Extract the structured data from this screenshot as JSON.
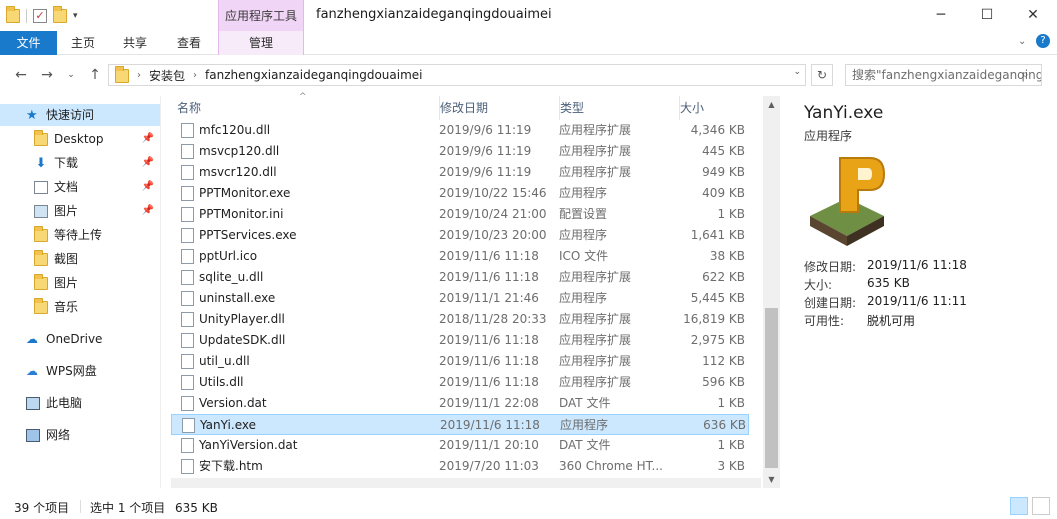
{
  "window": {
    "title": "fanzhengxianzaideganqingdouaimei",
    "context_header": "应用程序工具"
  },
  "ribbon": {
    "tabs": [
      {
        "id": "file",
        "label": "文件"
      },
      {
        "id": "home",
        "label": "主页"
      },
      {
        "id": "share",
        "label": "共享"
      },
      {
        "id": "view",
        "label": "查看"
      },
      {
        "id": "manage",
        "label": "管理"
      }
    ]
  },
  "address": {
    "crumbs": [
      "安装包",
      "fanzhengxianzaideganqingdouaimei"
    ],
    "search_placeholder": "搜索\"fanzhengxianzaideganqingdouaimei\""
  },
  "sidebar": {
    "quick_access": "快速访问",
    "items": [
      {
        "label": "Desktop",
        "pinned": true
      },
      {
        "label": "下载",
        "pinned": true
      },
      {
        "label": "文档",
        "pinned": true
      },
      {
        "label": "图片",
        "pinned": true
      },
      {
        "label": "等待上传",
        "pinned": false
      },
      {
        "label": "截图",
        "pinned": false
      },
      {
        "label": "图片",
        "pinned": false
      },
      {
        "label": "音乐",
        "pinned": false
      }
    ],
    "onedrive": "OneDrive",
    "wps": "WPS网盘",
    "thispc": "此电脑",
    "network": "网络"
  },
  "columns": {
    "name": "名称",
    "date": "修改日期",
    "type": "类型",
    "size": "大小"
  },
  "files": [
    {
      "name": "mfc120u.dll",
      "date": "2019/9/6 11:19",
      "type": "应用程序扩展",
      "size": "4,346 KB"
    },
    {
      "name": "msvcp120.dll",
      "date": "2019/9/6 11:19",
      "type": "应用程序扩展",
      "size": "445 KB"
    },
    {
      "name": "msvcr120.dll",
      "date": "2019/9/6 11:19",
      "type": "应用程序扩展",
      "size": "949 KB"
    },
    {
      "name": "PPTMonitor.exe",
      "date": "2019/10/22 15:46",
      "type": "应用程序",
      "size": "409 KB"
    },
    {
      "name": "PPTMonitor.ini",
      "date": "2019/10/24 21:00",
      "type": "配置设置",
      "size": "1 KB"
    },
    {
      "name": "PPTServices.exe",
      "date": "2019/10/23 20:00",
      "type": "应用程序",
      "size": "1,641 KB"
    },
    {
      "name": "pptUrl.ico",
      "date": "2019/11/6 11:18",
      "type": "ICO 文件",
      "size": "38 KB"
    },
    {
      "name": "sqlite_u.dll",
      "date": "2019/11/6 11:18",
      "type": "应用程序扩展",
      "size": "622 KB"
    },
    {
      "name": "uninstall.exe",
      "date": "2019/11/1 21:46",
      "type": "应用程序",
      "size": "5,445 KB"
    },
    {
      "name": "UnityPlayer.dll",
      "date": "2018/11/28 20:33",
      "type": "应用程序扩展",
      "size": "16,819 KB"
    },
    {
      "name": "UpdateSDK.dll",
      "date": "2019/11/6 11:18",
      "type": "应用程序扩展",
      "size": "2,975 KB"
    },
    {
      "name": "util_u.dll",
      "date": "2019/11/6 11:18",
      "type": "应用程序扩展",
      "size": "112 KB"
    },
    {
      "name": "Utils.dll",
      "date": "2019/11/6 11:18",
      "type": "应用程序扩展",
      "size": "596 KB"
    },
    {
      "name": "Version.dat",
      "date": "2019/11/1 22:08",
      "type": "DAT 文件",
      "size": "1 KB"
    },
    {
      "name": "YanYi.exe",
      "date": "2019/11/6 11:18",
      "type": "应用程序",
      "size": "636 KB",
      "selected": true
    },
    {
      "name": "YanYiVersion.dat",
      "date": "2019/11/1 20:10",
      "type": "DAT 文件",
      "size": "1 KB"
    },
    {
      "name": "安下载.htm",
      "date": "2019/7/20 11:03",
      "type": "360 Chrome HT...",
      "size": "3 KB"
    }
  ],
  "details": {
    "filename": "YanYi.exe",
    "filetype": "应用程序",
    "modified_label": "修改日期:",
    "modified": "2019/11/6 11:18",
    "size_label": "大小:",
    "size": "635 KB",
    "created_label": "创建日期:",
    "created": "2019/11/6 11:11",
    "availability_label": "可用性:",
    "availability": "脱机可用"
  },
  "status": {
    "count": "39 个项目",
    "selection": "选中 1 个项目",
    "sel_size": "635 KB"
  }
}
